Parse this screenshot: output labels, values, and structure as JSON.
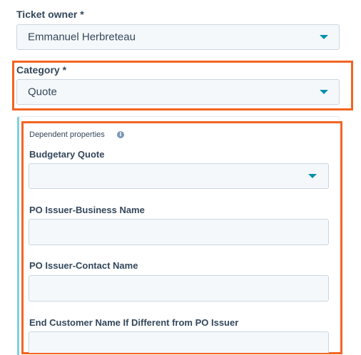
{
  "ticket_owner": {
    "label": "Ticket owner *",
    "value": "Emmanuel Herbreteau"
  },
  "category": {
    "label": "Category *",
    "value": "Quote"
  },
  "dependent_properties": {
    "title": "Dependent properties",
    "info_icon": "i",
    "fields": [
      {
        "label": "Budgetary Quote",
        "type": "select",
        "value": ""
      },
      {
        "label": "PO Issuer-Business Name",
        "type": "text",
        "value": ""
      },
      {
        "label": "PO Issuer-Contact Name",
        "type": "text",
        "value": ""
      },
      {
        "label": "End Customer Name If Different from PO Issuer",
        "type": "text",
        "value": ""
      }
    ]
  },
  "colors": {
    "highlight": "#f26522",
    "accent_bar": "#7fd1de",
    "caret": "#0091ae",
    "field_bg": "#f5f8fa",
    "text": "#33475b"
  },
  "icons": [
    "chevron-down-icon",
    "info-icon"
  ]
}
